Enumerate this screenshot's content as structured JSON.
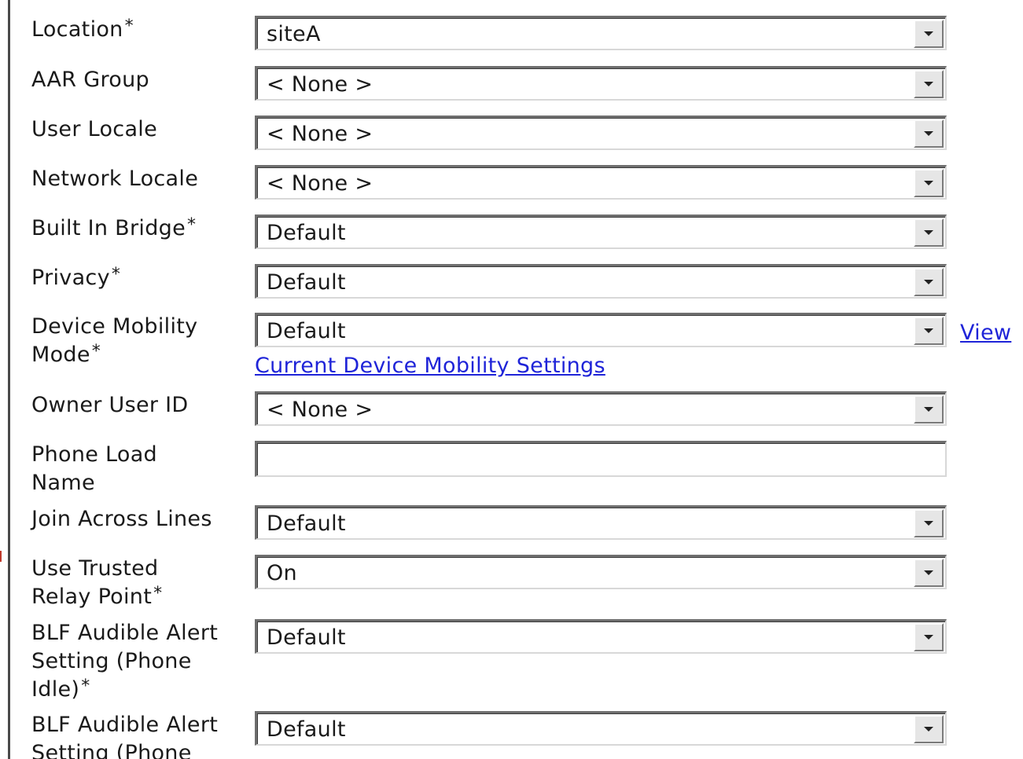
{
  "fields": [
    {
      "label": "Location",
      "required": true,
      "value": "siteA"
    },
    {
      "label": "AAR Group",
      "required": false,
      "value": "< None >"
    },
    {
      "label": "User Locale",
      "required": false,
      "value": "< None >"
    },
    {
      "label": "Network Locale",
      "required": false,
      "value": "< None >"
    },
    {
      "label": "Built In Bridge",
      "required": true,
      "value": "Default"
    },
    {
      "label": "Privacy",
      "required": true,
      "value": "Default"
    },
    {
      "label": "Device Mobility Mode",
      "required": true,
      "value": "Default"
    },
    {
      "label": "Owner User ID",
      "required": false,
      "value": "< None >"
    },
    {
      "label": "Phone Load Name",
      "required": false,
      "value": ""
    },
    {
      "label": "Join Across Lines",
      "required": false,
      "value": "Default"
    },
    {
      "label": "Use Trusted Relay Point",
      "required": true,
      "value": "On"
    },
    {
      "label": "BLF Audible Alert Setting (Phone Idle)",
      "required": true,
      "value": "Default"
    },
    {
      "label": "BLF Audible Alert Setting (Phone",
      "required": false,
      "value": "Default"
    }
  ],
  "required_marker": "*",
  "links": {
    "view": "View",
    "current_settings": "Current Device Mobility Settings"
  }
}
